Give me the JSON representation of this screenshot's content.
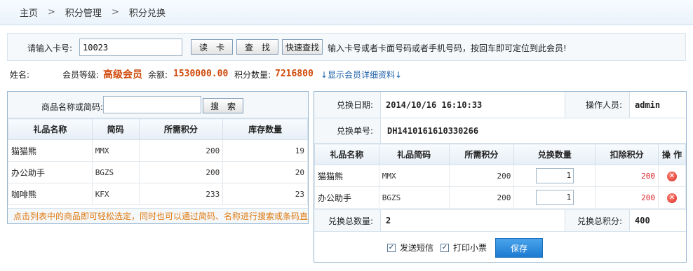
{
  "breadcrumb": {
    "home": "主页",
    "level1": "积分管理",
    "level2": "积分兑换",
    "separator": ">"
  },
  "card": {
    "label": "请输入卡号:",
    "value": "10023",
    "read_button": "读　卡",
    "find_button": "查　找",
    "quick_find_button": "快速查找",
    "hint": "输入卡号或者卡面号码或者手机号码，按回车即可定位到此会员!"
  },
  "member": {
    "name_label": "姓名:",
    "name": "",
    "level_label": "会员等级:",
    "level": "高级会员",
    "balance_label": "余额:",
    "balance": "1530000.00",
    "points_label": "积分数量:",
    "points": "7216800",
    "details_link": "↓显示会员详细资料↓"
  },
  "gift_search": {
    "label": "商品名称或简码:",
    "placeholder": "",
    "button": "搜　索"
  },
  "gift_table": {
    "headers": [
      "礼品名称",
      "简码",
      "所需积分",
      "库存数量"
    ],
    "rows": [
      [
        "猫猫熊",
        "MMX",
        "200",
        "19"
      ],
      [
        "办公助手",
        "BGZS",
        "200",
        "20"
      ],
      [
        "咖啡熊",
        "KFX",
        "233",
        "23"
      ]
    ]
  },
  "left_note": "点击列表中的商品即可轻松选定，同时也可以通过简码、名称进行搜索或条码直接定位!",
  "exchange": {
    "date_label": "兑换日期:",
    "date": "2014/10/16 16:10:33",
    "operator_label": "操作人员:",
    "operator": "admin",
    "order_label": "兑换单号:",
    "order": "DH1410161610330266",
    "headers": [
      "礼品名称",
      "礼品简码",
      "所需积分",
      "兑换数量",
      "扣除积分",
      "操 作"
    ],
    "rows": [
      [
        "猫猫熊",
        "MMX",
        "200",
        "1",
        "200"
      ],
      [
        "办公助手",
        "BGZS",
        "200",
        "1",
        "200"
      ]
    ],
    "total_qty_label": "兑换总数量:",
    "total_qty": "2",
    "total_points_label": "兑换总积分:",
    "total_points": "400",
    "send_sms": "发送短信",
    "print_ticket": "打印小票",
    "save": "保存"
  },
  "colors": {
    "accent": "#1c7bd2",
    "highlight": "#d04a0c",
    "note": "#e07a12",
    "delete": "#d9291f"
  },
  "icons": {
    "delete": "delete-circle-icon",
    "checkbox": "checkbox-checked-icon"
  }
}
